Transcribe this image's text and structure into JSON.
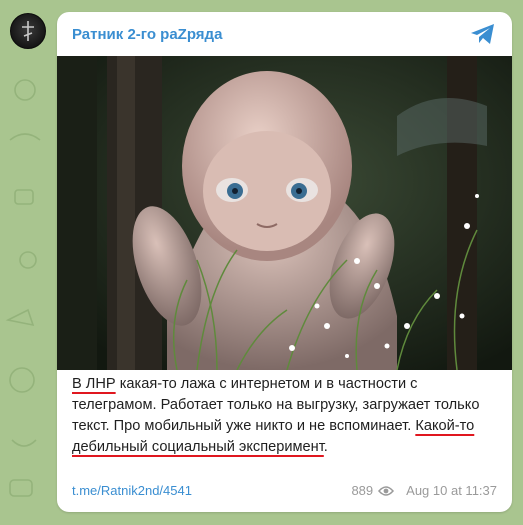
{
  "channel": {
    "name": "Ратник 2-го раZряда"
  },
  "icons": {
    "share": "telegram-share-icon",
    "views": "eye-icon",
    "avatar": "channel-avatar"
  },
  "colors": {
    "accent": "#3a8ed1",
    "background": "#a9c58f",
    "underline": "#e0171f",
    "meta": "#9a9a9a"
  },
  "message": {
    "part1_underlined": "В ЛНР",
    "part2": " какая-то лажа с интернетом и в частности с телеграмом. Работает только на выгрузку, загружает только текст. Про мобильный уже никто и не вспоминает. ",
    "part3_underlined": "Какой-то дебильный социальный эксперимент",
    "part4": "."
  },
  "footer": {
    "link": "t.me/Ratnik2nd/4541",
    "views": "889",
    "date": "Aug 10 at 11:37"
  }
}
